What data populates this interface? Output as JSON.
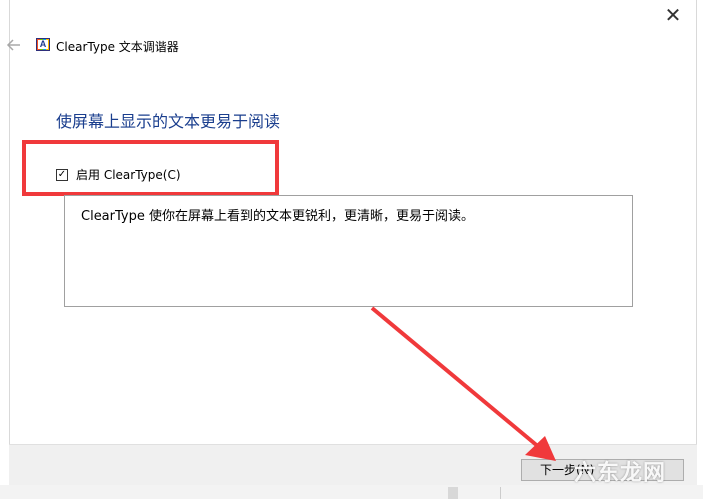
{
  "window": {
    "title": "ClearType 文本调谐器",
    "close_glyph": "✕",
    "back_glyph": "←",
    "app_icon_letter": "A"
  },
  "main": {
    "heading": "使屏幕上显示的文本更易于阅读",
    "checkbox": {
      "label": "启用 ClearType(C)",
      "checked": true,
      "glyph": "✓"
    },
    "description": "ClearType 使你在屏幕上看到的文本更锐利，更清晰，更易于阅读。"
  },
  "footer": {
    "next_label": "下一步(N)"
  },
  "annotation": {
    "color": "#f0393b",
    "watermark": "六东龙网"
  }
}
